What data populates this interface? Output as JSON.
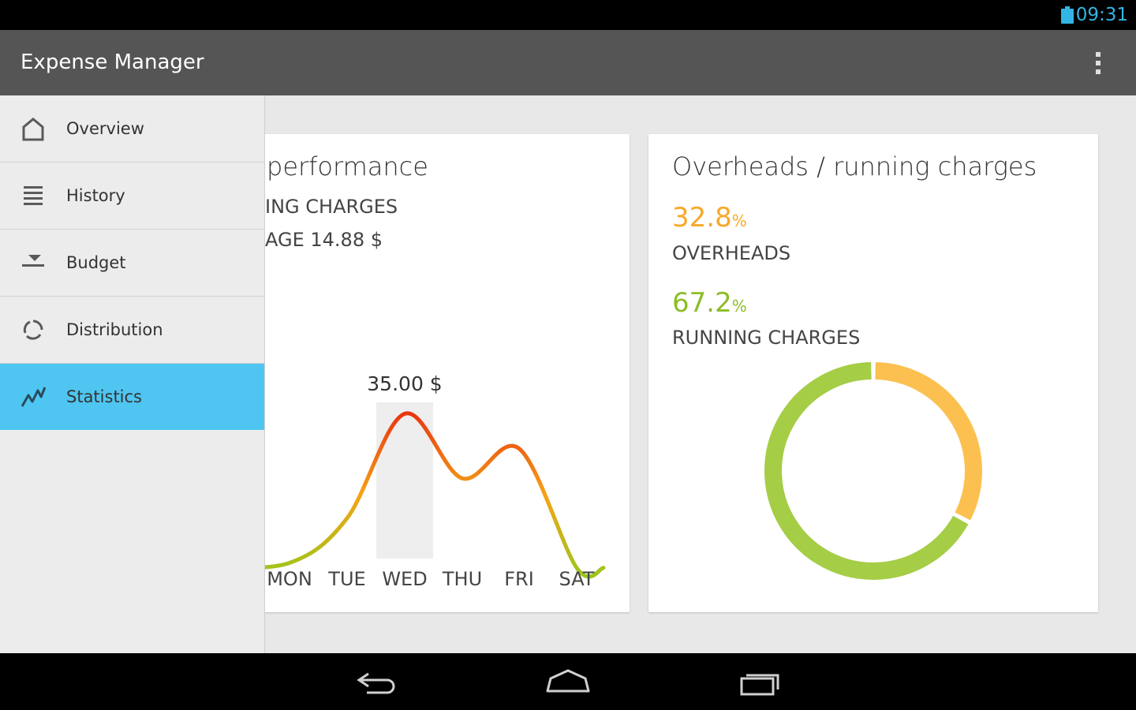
{
  "status_bar": {
    "time": "09:31",
    "battery_icon": "battery-icon",
    "accent": "#33b5e5"
  },
  "app_bar": {
    "title": "Expense Manager",
    "menu_icon": "overflow-menu-icon"
  },
  "drawer": {
    "items": [
      {
        "label": "Overview",
        "icon": "home-icon"
      },
      {
        "label": "History",
        "icon": "list-icon"
      },
      {
        "label": "Budget",
        "icon": "budget-icon"
      },
      {
        "label": "Distribution",
        "icon": "distribution-icon"
      },
      {
        "label": "Statistics",
        "icon": "statistics-icon",
        "active": true
      }
    ],
    "active_color": "#4fc5f1"
  },
  "performance_card": {
    "title_visible": "performance",
    "line1_visible": "ING CHARGES",
    "line2_visible": "AGE 14.88 $",
    "highlight_label": "35.00 $",
    "days": [
      "MON",
      "TUE",
      "WED",
      "THU",
      "FRI",
      "SAT"
    ]
  },
  "overheads_card": {
    "title": "Overheads / running charges",
    "overheads": {
      "value": "32.8",
      "unit": "%",
      "label": "OVERHEADS",
      "color": "#f8a829"
    },
    "running": {
      "value": "67.2",
      "unit": "%",
      "label": "RUNNING CHARGES",
      "color": "#8cbd26"
    }
  },
  "chart_data": [
    {
      "type": "line",
      "categories": [
        "MON",
        "TUE",
        "WED",
        "THU",
        "FRI",
        "SAT"
      ],
      "values": [
        5,
        14,
        35,
        22,
        28,
        4
      ],
      "highlight_category": "WED",
      "highlight_label": "35.00 $"
    },
    {
      "type": "pie",
      "title": "Overheads / running charges",
      "labels": [
        "OVERHEADS",
        "RUNNING CHARGES"
      ],
      "values": [
        32.8,
        67.2
      ],
      "colors": [
        "#fcc050",
        "#a5cd46"
      ]
    }
  ],
  "nav_bar": {
    "back_icon": "back-icon",
    "home_icon": "home-nav-icon",
    "recents_icon": "recents-icon"
  }
}
